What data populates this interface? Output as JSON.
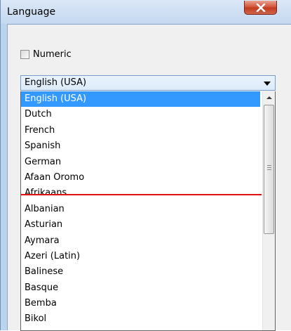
{
  "window": {
    "title": "Language",
    "close_icon": "close-x-icon"
  },
  "numeric": {
    "label": "Numeric",
    "checked": false
  },
  "combo": {
    "selected_value": "English (USA)",
    "arrow_icon": "chevron-down-icon"
  },
  "list": {
    "items": [
      "English (USA)",
      "Dutch",
      "French",
      "Spanish",
      "German",
      "Afaan Oromo",
      "Afrikaans",
      "Albanian",
      "Asturian",
      "Aymara",
      "Azeri (Latin)",
      "Balinese",
      "Basque",
      "Bemba",
      "Bikol"
    ],
    "selected_index": 0,
    "separator_after_index": 4
  },
  "colors": {
    "selection": "#3399ff",
    "separator": "#e01010",
    "close_button": "#c13c1f"
  }
}
